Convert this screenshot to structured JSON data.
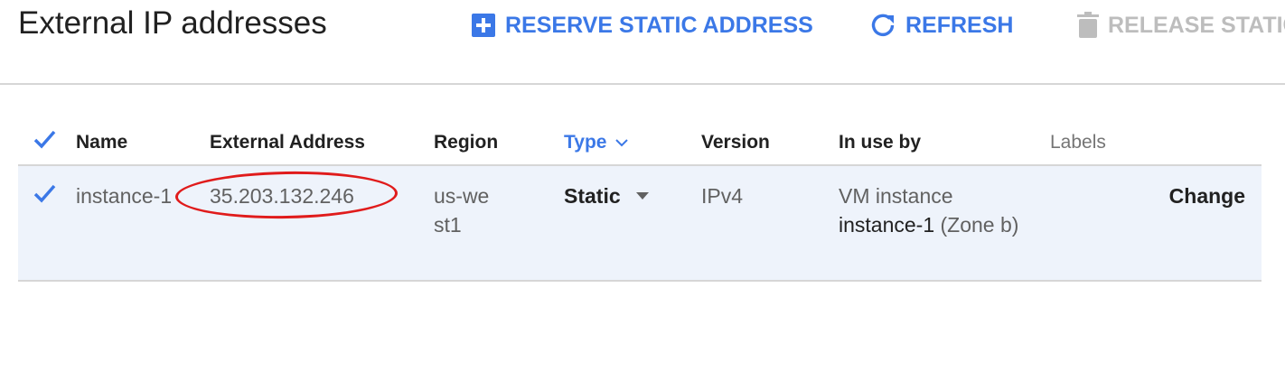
{
  "header": {
    "title": "External IP addresses",
    "reserve_label": "RESERVE STATIC ADDRESS",
    "refresh_label": "REFRESH",
    "release_label": "RELEASE STATIC"
  },
  "colors": {
    "accent": "#3b78e7",
    "disabled": "#bdbdbd",
    "selected_row_bg": "#eef3fb",
    "annotation": "#e01b1b"
  },
  "icons": {
    "reserve": "add-box-icon",
    "refresh": "refresh-icon",
    "release": "trash-icon",
    "sort": "chevron-down-icon",
    "type_dropdown": "dropdown-arrow-icon",
    "checkbox": "checkmark-icon"
  },
  "table": {
    "columns": [
      "Name",
      "External Address",
      "Region",
      "Type",
      "Version",
      "In use by",
      "Labels"
    ],
    "select_all_checked": true,
    "rows": [
      {
        "checked": true,
        "name": "instance-1",
        "external_address": "35.203.132.246",
        "region": "us-west1",
        "type": "Static",
        "version": "IPv4",
        "in_use_by_prefix": "VM instance",
        "in_use_by_instance": "instance-1",
        "in_use_by_zone": "(Zone b)",
        "labels": "",
        "action": "Change"
      }
    ]
  }
}
